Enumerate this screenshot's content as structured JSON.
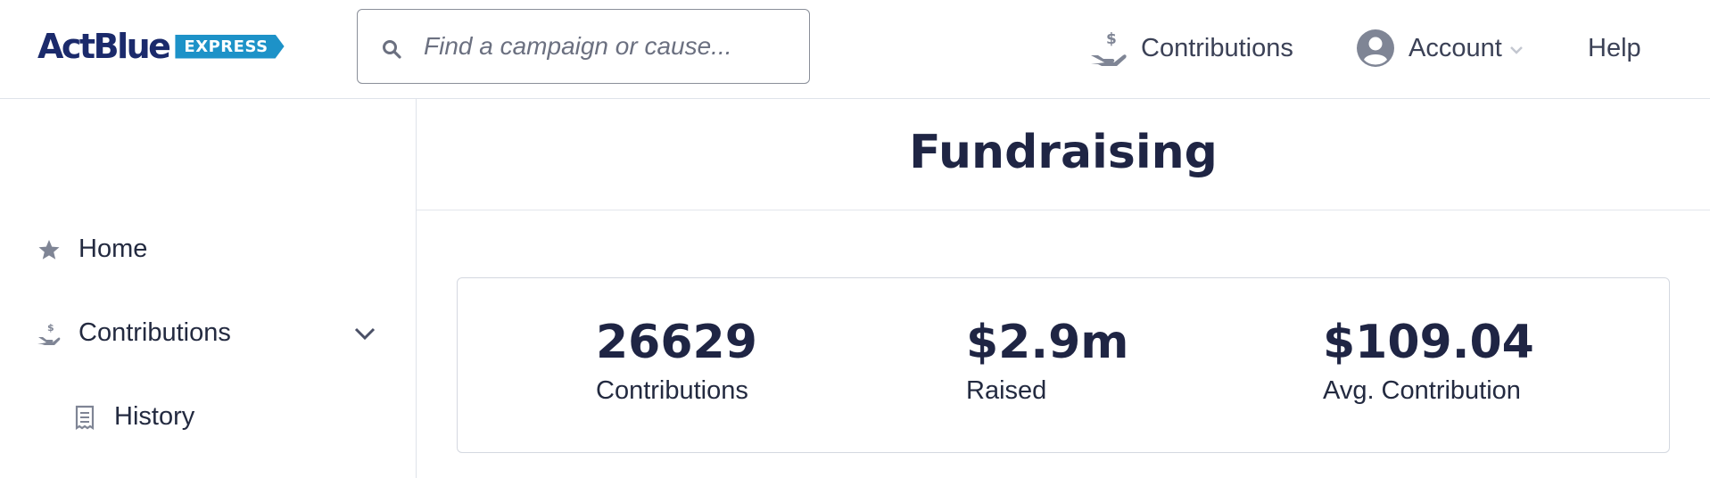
{
  "header": {
    "logo": {
      "wordmark": "ActBlue",
      "badge": "EXPRESS"
    },
    "search": {
      "placeholder": "Find a campaign or cause...",
      "value": ""
    },
    "nav": {
      "contributions_label": "Contributions",
      "account_label": "Account",
      "help_label": "Help"
    }
  },
  "sidebar": {
    "items": [
      {
        "label": "Home",
        "icon": "star-icon"
      },
      {
        "label": "Contributions",
        "icon": "hand-dollar-icon",
        "expanded": true
      },
      {
        "label": "History",
        "icon": "receipt-icon"
      }
    ]
  },
  "main": {
    "title": "Fundraising",
    "stats": [
      {
        "value": "26629",
        "label": "Contributions"
      },
      {
        "value": "$2.9m",
        "label": "Raised"
      },
      {
        "value": "$109.04",
        "label": "Avg. Contribution"
      }
    ]
  },
  "colors": {
    "brand_navy": "#1b2a6b",
    "brand_blue": "#1d92c8",
    "text_dark": "#1f2544",
    "icon_gray": "#7f8595",
    "border": "#dfe3ea"
  }
}
